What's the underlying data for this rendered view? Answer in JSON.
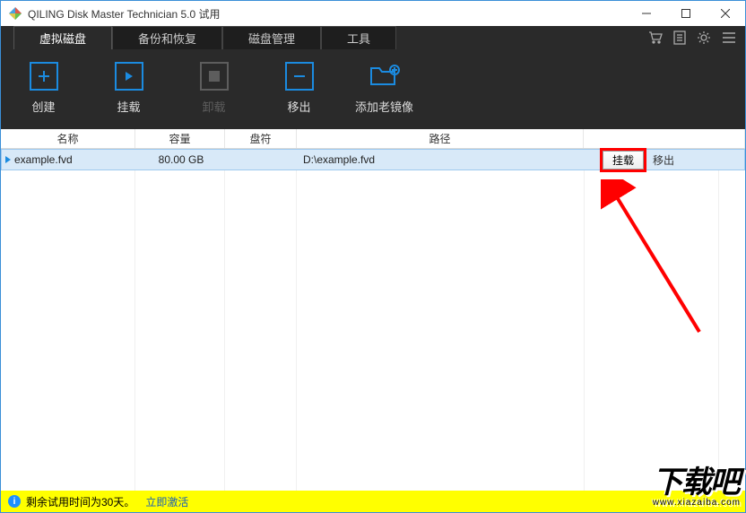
{
  "window": {
    "title": "QILING Disk Master Technician 5.0 试用"
  },
  "tabs": [
    {
      "label": "虚拟磁盘",
      "active": true
    },
    {
      "label": "备份和恢复"
    },
    {
      "label": "磁盘管理"
    },
    {
      "label": "工具"
    }
  ],
  "toolbar": {
    "create": "创建",
    "mount": "挂载",
    "unmount": "卸载",
    "remove": "移出",
    "add_old_image": "添加老镜像"
  },
  "columns": {
    "name": "名称",
    "capacity": "容量",
    "drive": "盘符",
    "path": "路径"
  },
  "rows": [
    {
      "name": "example.fvd",
      "capacity": "80.00 GB",
      "drive": "",
      "path": "D:\\example.fvd",
      "actions": {
        "mount": "挂载",
        "remove": "移出"
      }
    }
  ],
  "status": {
    "text": "剩余试用时间为30天。",
    "activate": "立即激活"
  },
  "watermark": {
    "big": "下载吧",
    "sub": "www.xiazaiba.com"
  }
}
